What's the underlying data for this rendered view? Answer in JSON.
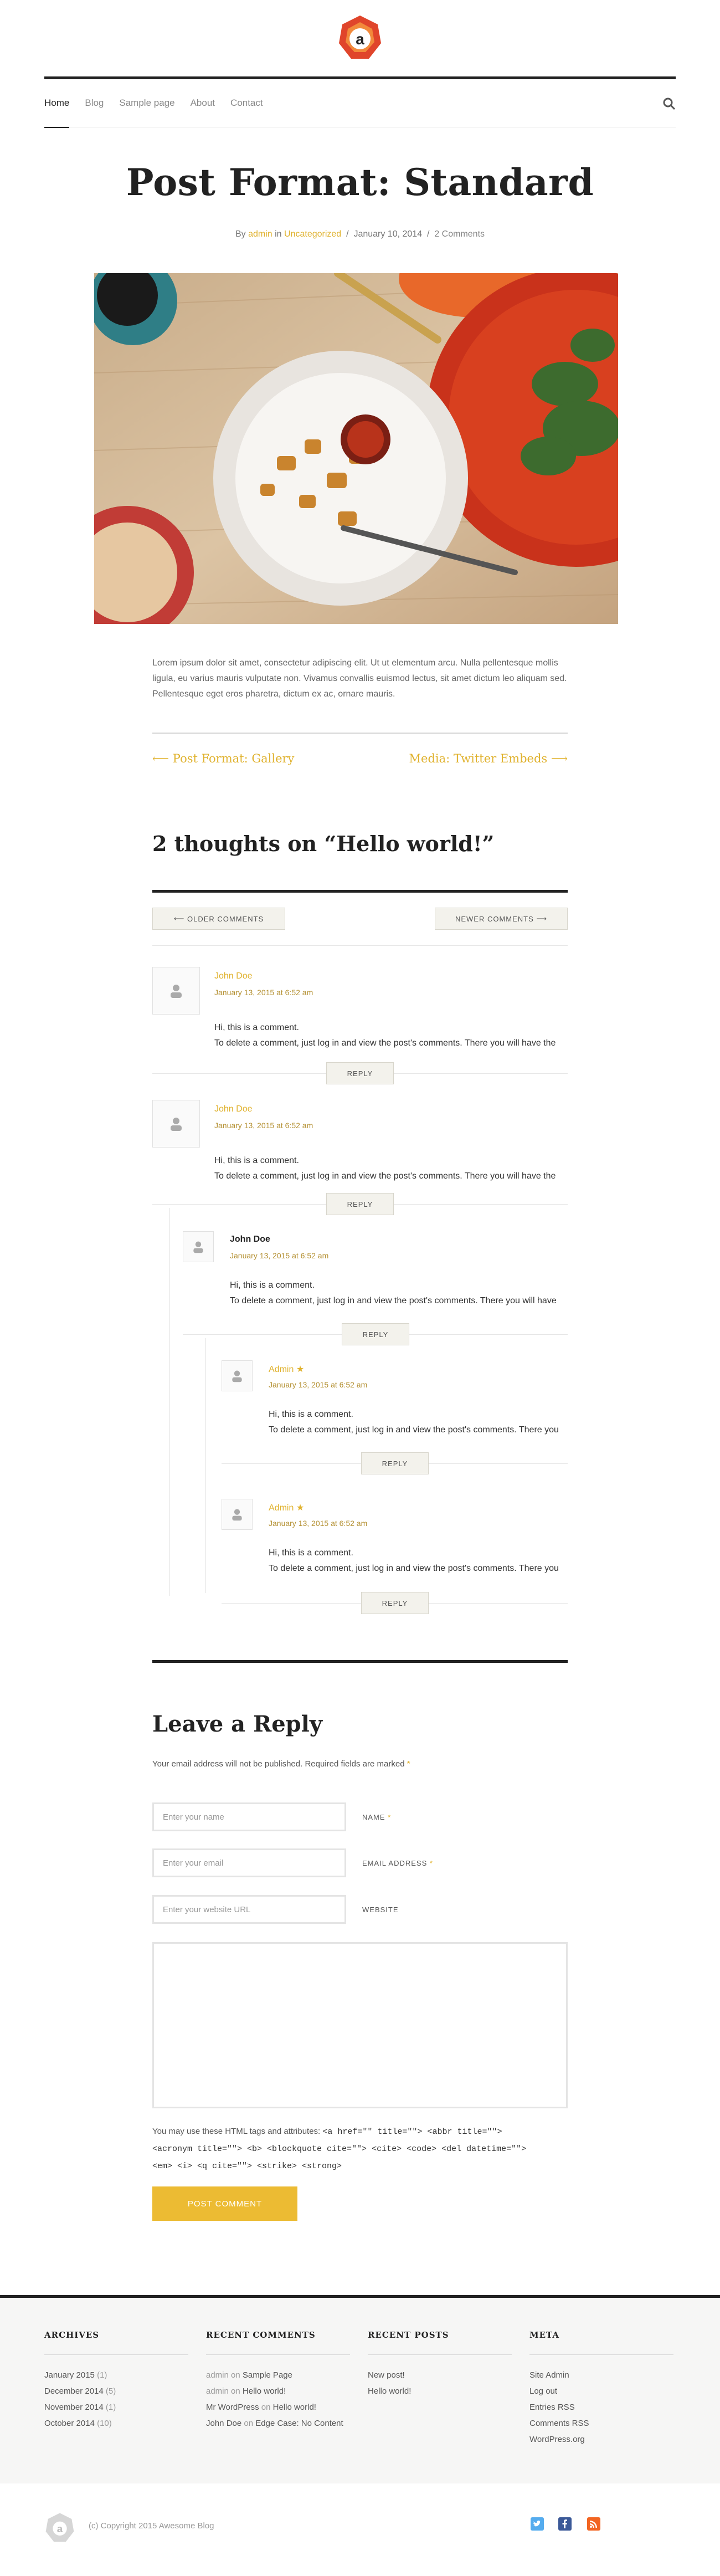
{
  "nav": {
    "items": [
      "Home",
      "Blog",
      "Sample page",
      "About",
      "Contact"
    ],
    "search_icon": "search-icon"
  },
  "post": {
    "title": "Post Format: Standard",
    "meta": {
      "by": "By",
      "author": "admin",
      "in": "in",
      "category": "Uncategorized",
      "sep1": "/",
      "date": "January 10, 2014",
      "sep2": "/",
      "comments": "2 Comments"
    },
    "excerpt": "Lorem ipsum dolor sit amet, consectetur adipiscing elit. Ut ut elementum arcu. Nulla pellentesque mollis ligula, eu varius mauris vulputate non. Vivamus convallis euismod lectus, sit amet dictum leo aliquam sed. Pellentesque eget eros pharetra, dictum ex ac, ornare mauris."
  },
  "post_nav": {
    "prev": "Post Format: Gallery",
    "next": "Media: Twitter Embeds"
  },
  "comments_section": {
    "title": "2 thoughts on “Hello world!”",
    "older": "OLDER COMMENTS",
    "newer": "NEWER COMMENTS",
    "reply_label": "REPLY",
    "items": [
      {
        "author": "John Doe",
        "date": "January 13, 2015 at 6:52 am",
        "line1": "Hi, this is a comment.",
        "line2": "To delete a comment, just log in and view the post's comments. There you will have the"
      },
      {
        "author": "John Doe",
        "date": "January 13, 2015 at 6:52 am",
        "line1": "Hi, this is a comment.",
        "line2": "To delete a comment, just log in and view the post's comments. There you will have the"
      },
      {
        "author": "John Doe",
        "date": "January 13, 2015 at 6:52 am",
        "line1": "Hi, this is a comment.",
        "line2": "To delete a comment, just log in and view the post's comments. There you will have"
      },
      {
        "author": "Admin",
        "date": "January 13, 2015 at 6:52 am",
        "line1": "Hi, this is a comment.",
        "line2": "To delete a comment, just log in and view the post's comments. There you"
      },
      {
        "author": "Admin",
        "date": "January 13, 2015 at 6:52 am",
        "line1": "Hi, this is a comment.",
        "line2": "To delete a comment, just log in and view the post's comments. There you"
      }
    ]
  },
  "reply_form": {
    "title": "Leave a Reply",
    "notes": "Your email address will not be published. Required fields are marked",
    "required_mark": "*",
    "name_placeholder": "Enter your name",
    "name_label": "NAME",
    "email_placeholder": "Enter your email",
    "email_label": "EMAIL ADDRESS",
    "url_placeholder": "Enter your website URL",
    "url_label": "WEBSITE",
    "allowed_intro": "You may use these HTML tags and attributes:",
    "allowed_tags_1": "<a href=\"\" title=\"\"> <abbr title=\"\">",
    "allowed_tags_2": "<acronym title=\"\"> <b> <blockquote cite=\"\"> <cite> <code> <del datetime=\"\">",
    "allowed_tags_3": "<em> <i> <q cite=\"\"> <strike> <strong>",
    "submit": "POST COMMENT"
  },
  "footer": {
    "archives": {
      "title": "ARCHIVES",
      "items": [
        {
          "label": "January 2015",
          "count": "(1)"
        },
        {
          "label": "December 2014",
          "count": "(5)"
        },
        {
          "label": "November 2014",
          "count": "(1)"
        },
        {
          "label": "October 2014",
          "count": "(10)"
        }
      ]
    },
    "recent_comments": {
      "title": "RECENT COMMENTS",
      "items": [
        {
          "who": "admin",
          "on": "on",
          "what": "Sample Page"
        },
        {
          "who": "admin",
          "on": "on",
          "what": "Hello world!"
        },
        {
          "who": "Mr WordPress",
          "on": "on",
          "what": "Hello world!"
        },
        {
          "who": "John Doe",
          "on": "on",
          "what": "Edge Case: No Content"
        }
      ]
    },
    "recent_posts": {
      "title": "RECENT POSTS",
      "items": [
        "New post!",
        "Hello world!"
      ]
    },
    "meta": {
      "title": "META",
      "items": [
        "Site Admin",
        "Log out",
        "Entries RSS",
        "Comments RSS",
        "WordPress.org"
      ]
    },
    "copyright": "(c) Copyright 2015 Awesome Blog"
  },
  "colors": {
    "accent": "#ecbb33",
    "dark": "#222222",
    "logo_red": "#e0452b",
    "twitter": "#55acee",
    "facebook": "#3b5998",
    "rss": "#f26522"
  }
}
